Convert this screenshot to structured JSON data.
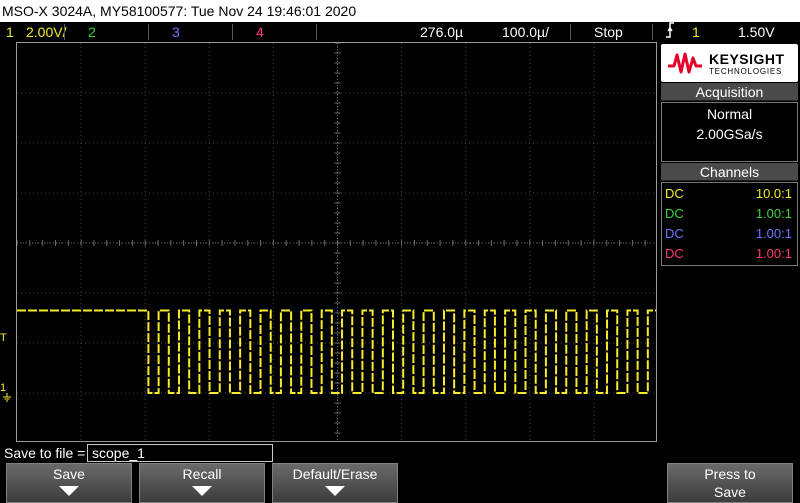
{
  "title": "MSO-X 3024A, MY58100577: Tue Nov 24 19:46:01 2020",
  "status": {
    "ch1_num": "1",
    "ch1_scale": "2.00V/",
    "ch2_num": "2",
    "ch3_num": "3",
    "ch4_num": "4",
    "time_delay": "276.0µ",
    "time_scale": "100.0µ/",
    "run_state": "Stop",
    "trigger_icon": "edge-trigger-icon",
    "trigger_source": "1",
    "trigger_level": "1.50V"
  },
  "markers": {
    "ch1": "1",
    "trigger_level": "T"
  },
  "brand": {
    "name": "KEYSIGHT",
    "sub": "TECHNOLOGIES",
    "color": "#e4002b"
  },
  "acquisition": {
    "title": "Acquisition",
    "mode": "Normal",
    "rate": "2.00GSa/s"
  },
  "channels": {
    "title": "Channels",
    "rows": [
      {
        "coupling": "DC",
        "probe": "10.0:1",
        "color": "#f5ec2a"
      },
      {
        "coupling": "DC",
        "probe": "1.00:1",
        "color": "#3dd23d"
      },
      {
        "coupling": "DC",
        "probe": "1.00:1",
        "color": "#6f73ff"
      },
      {
        "coupling": "DC",
        "probe": "1.00:1",
        "color": "#ff3a6e"
      }
    ]
  },
  "save": {
    "label": "Save to file =",
    "filename": "scope_1"
  },
  "softkeys": {
    "save": "Save",
    "recall": "Recall",
    "default_erase": "Default/Erase",
    "press_to": "Press to",
    "press_save": "Save"
  },
  "waveform": {
    "color": "#f5ec2a",
    "low_v": 0.0,
    "high_v": 3.3,
    "idle_until_div": 2.05,
    "pulse_period_div": 0.318,
    "duty": 0.5
  },
  "colors": {
    "grid": "#4a4a4a",
    "accent_orange": "#f08c1a"
  }
}
